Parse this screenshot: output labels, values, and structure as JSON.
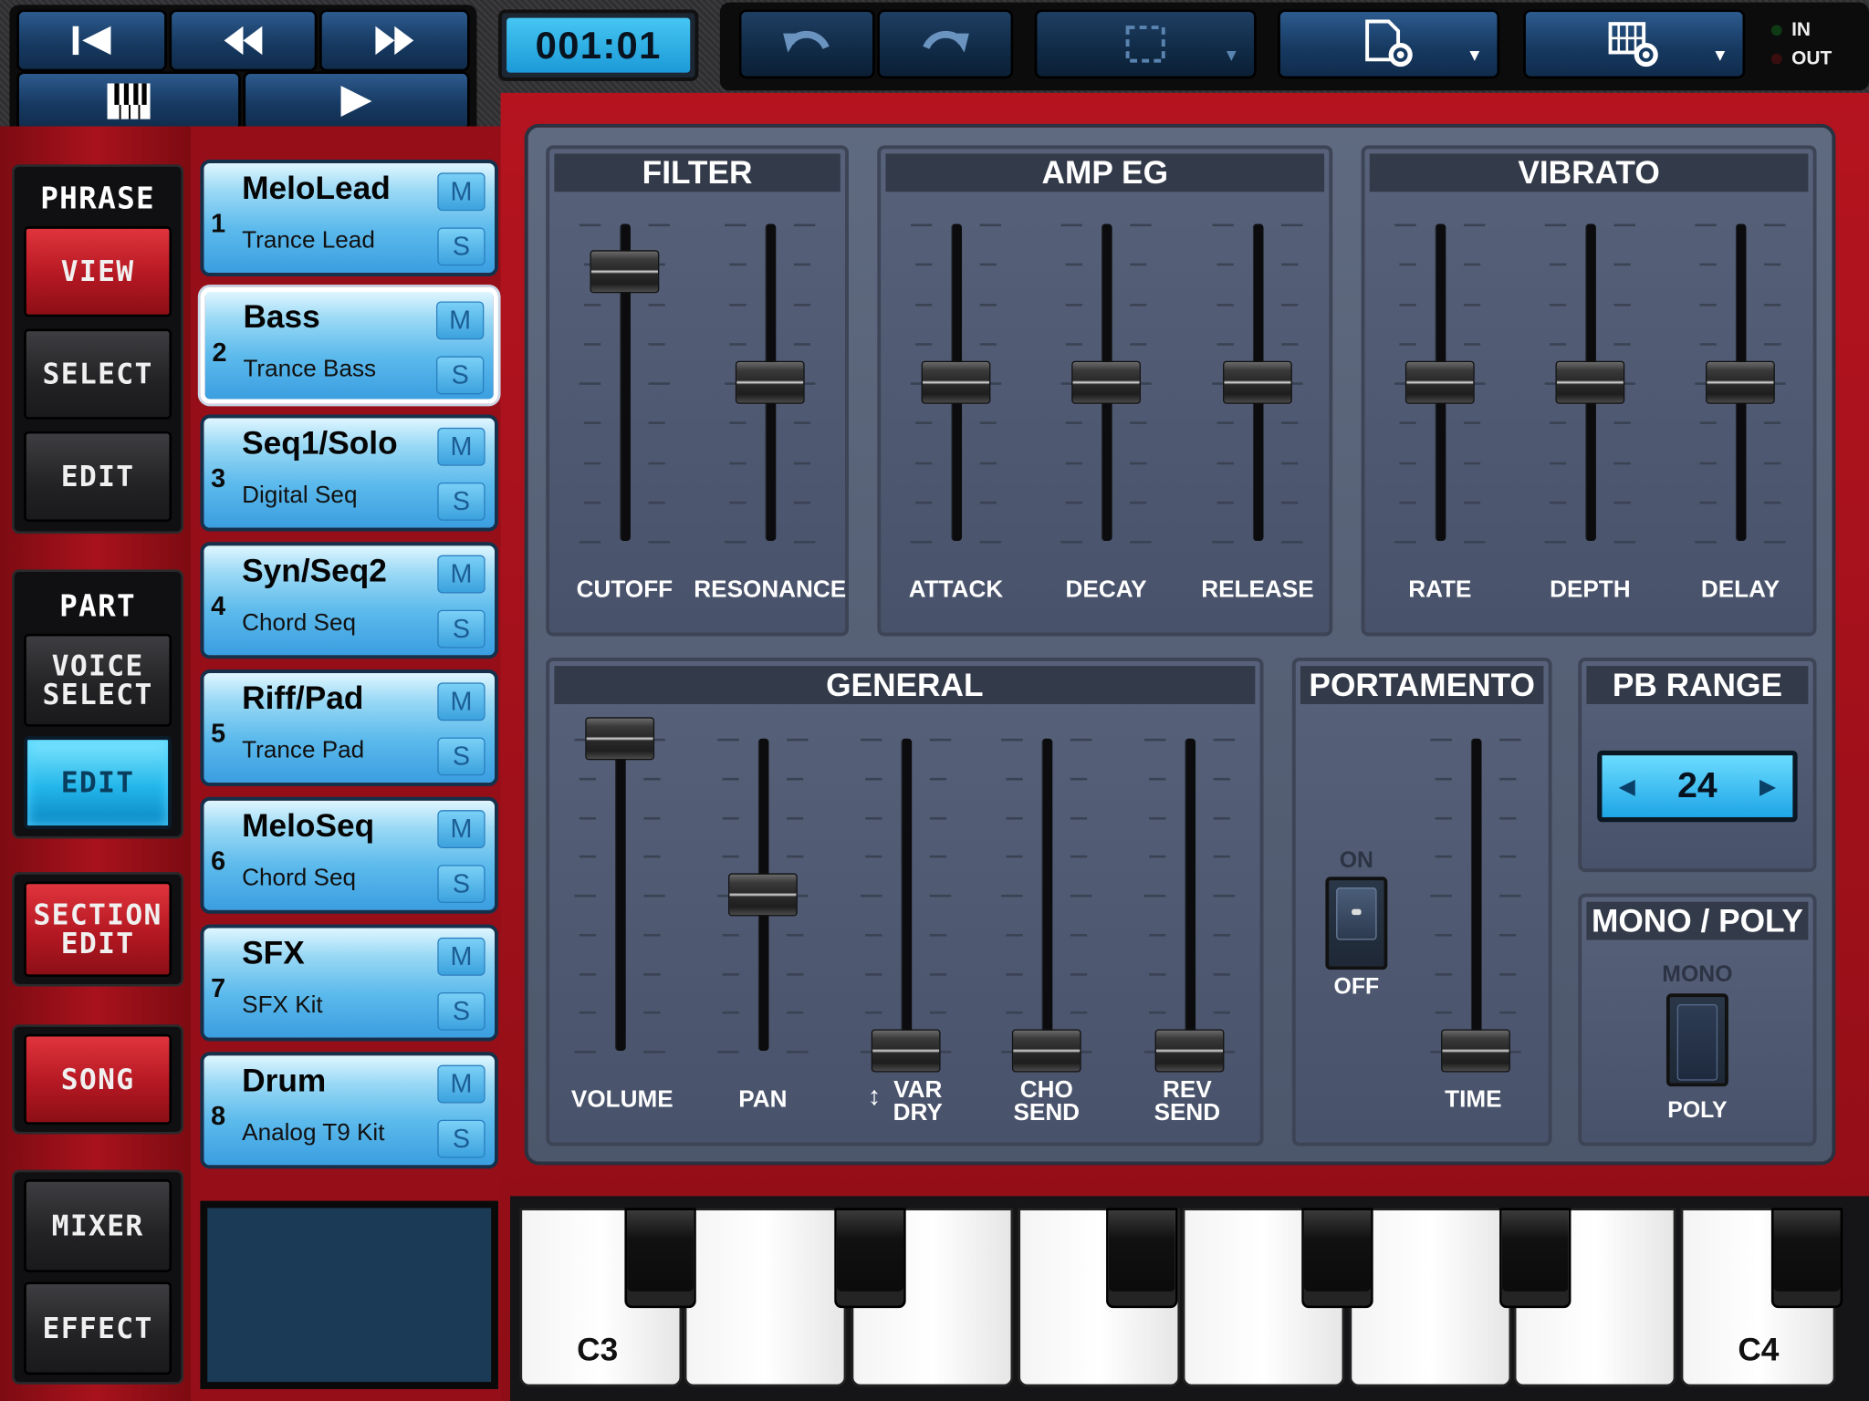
{
  "transport": {
    "time": "001:01"
  },
  "io": {
    "in_label": "IN",
    "out_label": "OUT"
  },
  "nav": {
    "phrase_label": "PHRASE",
    "view_label": "VIEW",
    "select_label": "SELECT",
    "edit_label": "EDIT",
    "part_label": "PART",
    "voice_select_line1": "VOICE",
    "voice_select_line2": "SELECT",
    "part_edit_label": "EDIT",
    "section_edit_line1": "SECTION",
    "section_edit_line2": "EDIT",
    "song_label": "SONG",
    "mixer_label": "MIXER",
    "effect_label": "EFFECT"
  },
  "parts": [
    {
      "num": "1",
      "name": "MeloLead",
      "voice": "Trance Lead",
      "m": "M",
      "s": "S"
    },
    {
      "num": "2",
      "name": "Bass",
      "voice": "Trance Bass",
      "m": "M",
      "s": "S"
    },
    {
      "num": "3",
      "name": "Seq1/Solo",
      "voice": "Digital Seq",
      "m": "M",
      "s": "S"
    },
    {
      "num": "4",
      "name": "Syn/Seq2",
      "voice": "Chord Seq",
      "m": "M",
      "s": "S"
    },
    {
      "num": "5",
      "name": "Riff/Pad",
      "voice": "Trance Pad",
      "m": "M",
      "s": "S"
    },
    {
      "num": "6",
      "name": "MeloSeq",
      "voice": "Chord Seq",
      "m": "M",
      "s": "S"
    },
    {
      "num": "7",
      "name": "SFX",
      "voice": "SFX Kit",
      "m": "M",
      "s": "S"
    },
    {
      "num": "8",
      "name": "Drum",
      "voice": "Analog T9 Kit",
      "m": "M",
      "s": "S"
    }
  ],
  "sections": {
    "filter": "FILTER",
    "amp_eg": "AMP EG",
    "vibrato": "VIBRATO",
    "general": "GENERAL",
    "portamento": "PORTAMENTO",
    "pb_range": "PB RANGE",
    "mono_poly": "MONO / POLY"
  },
  "sliders": {
    "cutoff": {
      "label": "CUTOFF",
      "level": 0.85
    },
    "resonance": {
      "label": "RESONANCE",
      "level": 0.5
    },
    "attack": {
      "label": "ATTACK",
      "level": 0.5
    },
    "decay": {
      "label": "DECAY",
      "level": 0.5
    },
    "release": {
      "label": "RELEASE",
      "level": 0.5
    },
    "rate": {
      "label": "RATE",
      "level": 0.5
    },
    "depth": {
      "label": "DEPTH",
      "level": 0.5
    },
    "delay": {
      "label": "DELAY",
      "level": 0.5
    },
    "volume": {
      "label": "VOLUME",
      "level": 1.0
    },
    "pan": {
      "label": "PAN",
      "level": 0.5
    },
    "var_dry": {
      "line1": "VAR",
      "line2": "DRY",
      "level": 0.0
    },
    "cho_send": {
      "line1": "CHO",
      "line2": "SEND",
      "level": 0.0
    },
    "rev_send": {
      "line1": "REV",
      "line2": "SEND",
      "level": 0.0
    },
    "time": {
      "label": "TIME",
      "level": 0.0
    }
  },
  "portamento": {
    "on_label": "ON",
    "off_label": "OFF"
  },
  "pb_range": {
    "value": "24"
  },
  "mono_poly": {
    "mono_label": "MONO",
    "poly_label": "POLY"
  },
  "keyboard": {
    "low_label": "C3",
    "high_label": "C4"
  },
  "colors": {
    "accent_cyan": "#23b6ea",
    "frame_red": "#a8121c",
    "panel_slate": "#56607a"
  }
}
